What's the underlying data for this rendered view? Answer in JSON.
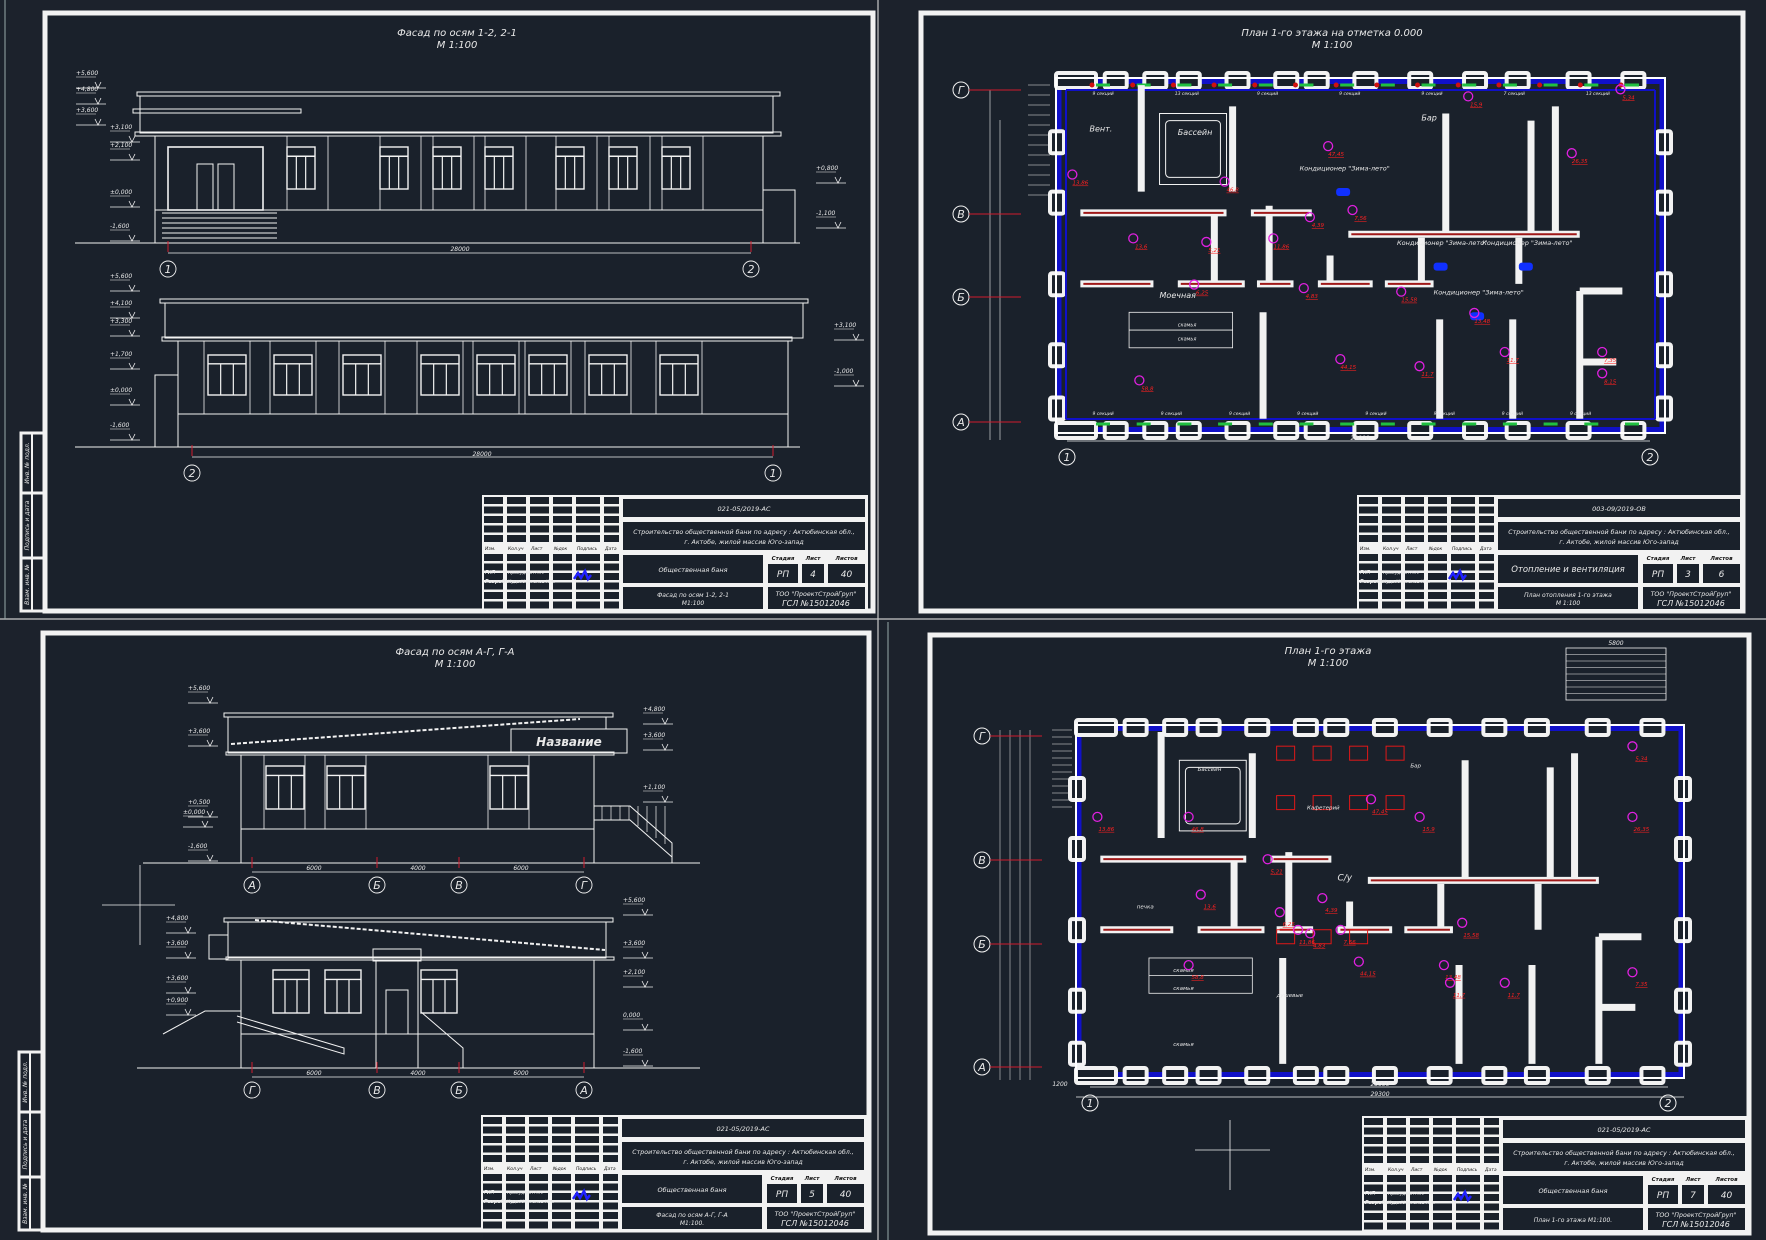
{
  "colors": {
    "background": "#1c222c",
    "sheet": "#1a212b",
    "line": "#f2f2f2",
    "axis_mark": "#d01c2c",
    "window_band": "#1010c8",
    "radiator": "#d01010",
    "room_marker": "#e020e0",
    "area_text": "#ff2020",
    "conditioner": "#1030ff",
    "valve": "#20c0d0"
  },
  "margin_strip": [
    "Взам. инв. №",
    "Подпись и дата",
    "Инв. № подл."
  ],
  "sheets": [
    {
      "title": "Фасад по осям 1-2, 2-1",
      "scale": "М 1:100",
      "elevations": [
        {
          "levels_left": [
            "+5,600",
            "+4,800",
            "+3,600",
            "+3,100",
            "+2,100",
            "±0,000",
            "-1,600"
          ],
          "levels_right": [
            "+0,800",
            "-1,100"
          ],
          "dimension": "28000",
          "axes": [
            "1",
            "2"
          ]
        },
        {
          "levels_left": [
            "+5,600",
            "+4,100",
            "+3,300",
            "+1,700",
            "±0,000",
            "-1,600"
          ],
          "levels_right": [
            "+3,100",
            "-1,000"
          ],
          "dimension": "28000",
          "axes": [
            "2",
            "1"
          ]
        }
      ],
      "title_block": {
        "code": "021-05/2019-АС",
        "project": [
          "Строительство общественной бани по адресу : Актюбинская обл.,",
          "г. Актобе, жилой массив Юго-запад"
        ],
        "object": "Общественная баня",
        "stage_label": "Стадия",
        "sheet_label": "Лист",
        "sheets_label": "Листов",
        "stage": "РП",
        "sheet": "4",
        "sheets": "40",
        "drawing": [
          "Фасад по осям 1-2, 2-1",
          "М1:100"
        ],
        "company": [
          "ТОО \"ПроектСтройГруп\"",
          "ГСЛ №15012046"
        ],
        "columns": [
          "Изм.",
          "Кол.уч",
          "Лист",
          "№док",
          "Подпись",
          "Дата"
        ],
        "roles": [
          "ГИП",
          "Разработал"
        ],
        "names": [
          "Прокудкин А.А.",
          "Кудайбергенов К.А."
        ]
      }
    },
    {
      "title": "План 1-го этажа на отметка 0.000",
      "scale": "М 1:100",
      "axes_letters": [
        "Г",
        "В",
        "Б",
        "А"
      ],
      "axes_numbers": [
        "1",
        "2"
      ],
      "dimension": "28000",
      "rooms": [
        "Вент.",
        "Бассейн",
        "Моечная",
        "скамья",
        "скамья",
        "Бар"
      ],
      "conditioners": [
        "Кондиционер \"Зима-лето\"",
        "Кондиционер \"Зима-лето\"",
        "Кондиционер \"Зима-лето\"",
        "Кондиционер \"Зима-лето\""
      ],
      "radiators": [
        "9 секций",
        "13 секций",
        "9 секций",
        "9 секций",
        "9 секций",
        "7 секций",
        "13 секций",
        "9 секций",
        "9 секций",
        "9 секций",
        "9 секций",
        "9 секций",
        "9 секций",
        "9 секций",
        "9 секций"
      ],
      "areas": [
        "47,45",
        "15,9",
        "13,86",
        "46,8",
        "5,21",
        "13,6",
        "6,25",
        "11,86",
        "4,39",
        "7,56",
        "4,83",
        "15,58",
        "13,48",
        "11,7",
        "11,7",
        "7,35",
        "8,15",
        "58,8",
        "44,15",
        "26,35",
        "5,34"
      ],
      "title_block": {
        "code": "003-09/2019-ОВ",
        "project": [
          "Строительство общественной бани по адресу : Актюбинская обл.,",
          "г. Актобе, жилой массив Юго-запад"
        ],
        "object": "Отопление и вентиляция",
        "stage_label": "Стадия",
        "sheet_label": "Лист",
        "sheets_label": "Листов",
        "stage": "РП",
        "sheet": "3",
        "sheets": "6",
        "drawing": [
          "План отопления 1-го этажа",
          "М 1:100"
        ],
        "company": [
          "ТОО \"ПроектСтройГруп\"",
          "ГСЛ №15012046"
        ],
        "columns": [
          "Изм.",
          "Кол.уч",
          "Лист",
          "№док",
          "Подпись",
          "Дата"
        ],
        "roles": [
          "ГИП",
          "Разработал"
        ],
        "names": [
          "Прокудкин А.А.",
          "Кудайбергенов К.А."
        ]
      }
    },
    {
      "title": "Фасад по осям А-Г, Г-А",
      "scale": "М 1:100",
      "elevations": [
        {
          "levels_left": [
            "+5,600",
            "+3,600",
            "+0,500",
            "±0,000",
            "-1,600"
          ],
          "levels_right": [
            "+4,800",
            "+3,600",
            "+1,100"
          ],
          "dimensions": [
            "6000",
            "4000",
            "6000"
          ],
          "axes": [
            "А",
            "Б",
            "В",
            "Г"
          ],
          "sign": "Название"
        },
        {
          "levels_left": [
            "+4,800",
            "+3,600",
            "+3,600",
            "+0,900"
          ],
          "levels_right": [
            "+5,600",
            "+3,600",
            "+2,100",
            "0,000",
            "-1,600"
          ],
          "dimensions": [
            "6000",
            "4000",
            "6000"
          ],
          "axes": [
            "Г",
            "В",
            "Б",
            "А"
          ]
        }
      ],
      "title_block": {
        "code": "021-05/2019-АС",
        "project": [
          "Строительство общественной бани по адресу : Актюбинская обл.,",
          "г. Актобе, жилой массив Юго-запад"
        ],
        "object": "Общественная баня",
        "stage_label": "Стадия",
        "sheet_label": "Лист",
        "sheets_label": "Листов",
        "stage": "РП",
        "sheet": "5",
        "sheets": "40",
        "drawing": [
          "Фасад по осям А-Г, Г-А",
          "М1:100."
        ],
        "company": [
          "ТОО \"ПроектСтройГруп\"",
          "ГСЛ №15012046"
        ],
        "columns": [
          "Изм.",
          "Кол.уч",
          "Лист",
          "№док",
          "Подпись",
          "Дата"
        ],
        "roles": [
          "ГИП",
          "Разработал"
        ],
        "names": [
          "Прокудкин А.А.",
          "Кудайбергенов К.А."
        ]
      }
    },
    {
      "title": "План 1-го этажа",
      "scale": "М 1:100",
      "axes_letters": [
        "Г",
        "В",
        "Б",
        "А"
      ],
      "axes_numbers": [
        "1",
        "2"
      ],
      "dimensions": [
        "28000",
        "29300",
        "1200",
        "5800"
      ],
      "rooms": [
        "Бассейн",
        "Кафетерий",
        "Бар",
        "С/у",
        "скамья",
        "скамья",
        "скамья",
        "душевые",
        "печка"
      ],
      "areas": [
        "13,86",
        "46,8",
        "5,21",
        "13,6",
        "6,25",
        "11,86",
        "4,39",
        "7,56",
        "4,83",
        "15,58",
        "13,48",
        "11,7",
        "11,7",
        "7,35",
        "58,8",
        "44,15",
        "26,35",
        "5,34",
        "47,45",
        "15,9"
      ],
      "title_block": {
        "code": "021-05/2019-АС",
        "project": [
          "Строительство общественной бани по адресу : Актюбинская обл.,",
          "г. Актобе, жилой массив Юго-запад"
        ],
        "object": "Общественная баня",
        "stage_label": "Стадия",
        "sheet_label": "Лист",
        "sheets_label": "Листов",
        "stage": "РП",
        "sheet": "7",
        "sheets": "40",
        "drawing": [
          "План 1-го этажа М1:100."
        ],
        "company": [
          "ТОО \"ПроектСтройГруп\"",
          "ГСЛ №15012046"
        ],
        "columns": [
          "Изм.",
          "Кол.уч",
          "Лист",
          "№док",
          "Подпись",
          "Дата"
        ],
        "roles": [
          "ГИП",
          "Разработал"
        ],
        "names": [
          "Прокудкин А.А.",
          "Кудайбергенов К.А."
        ]
      }
    }
  ]
}
